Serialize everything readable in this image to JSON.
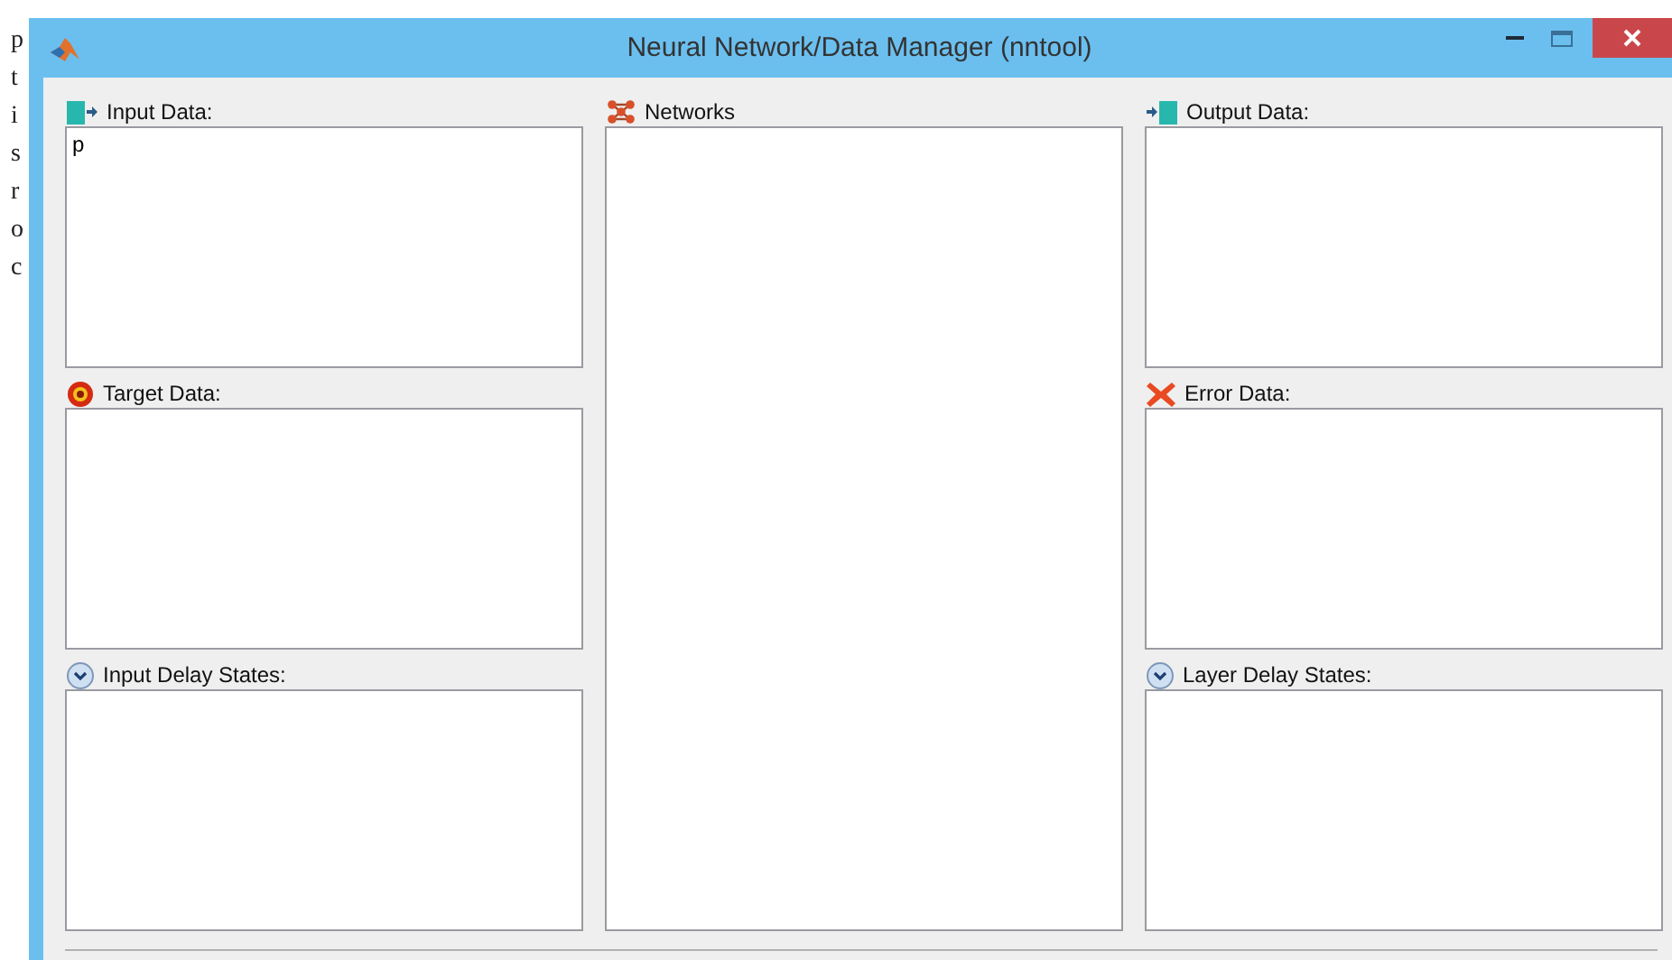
{
  "background_text": [
    "p",
    "t",
    "i",
    "s",
    "r",
    "o",
    "c"
  ],
  "window": {
    "title": "Neural Network/Data Manager (nntool)"
  },
  "columns": [
    {
      "panels": [
        {
          "kind": "input",
          "label": "Input Data:",
          "items": [
            "p"
          ]
        },
        {
          "kind": "target",
          "label": "Target Data:"
        },
        {
          "kind": "delay",
          "label": "Input Delay States:"
        }
      ]
    },
    {
      "panels": [
        {
          "kind": "networks",
          "label": "Networks"
        }
      ]
    },
    {
      "panels": [
        {
          "kind": "output",
          "label": "Output Data:"
        },
        {
          "kind": "error",
          "label": "Error Data:"
        },
        {
          "kind": "delay",
          "label": "Layer Delay States:"
        }
      ]
    }
  ]
}
